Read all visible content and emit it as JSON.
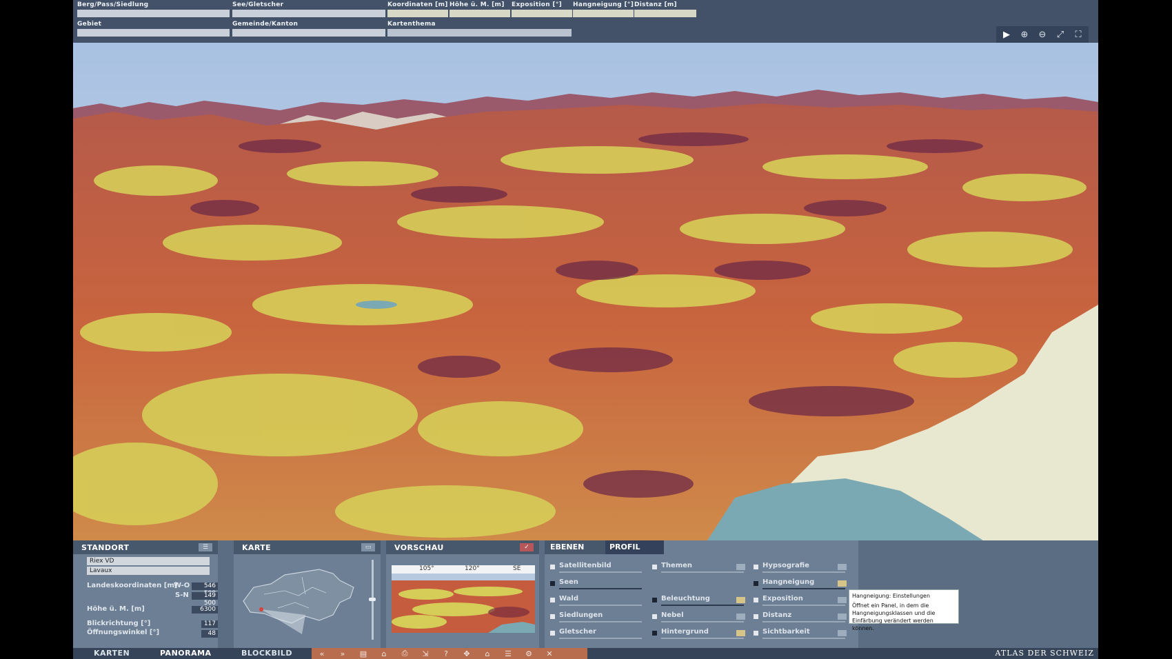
{
  "topbar": {
    "fields": {
      "berg": "Berg/Pass/Siedlung",
      "see": "See/Gletscher",
      "koord": "Koordinaten [m]",
      "hoehe": "Höhe ü. M. [m]",
      "expo": "Exposition [°]",
      "neigung": "Hangneigung [°]",
      "distanz": "Distanz [m]",
      "gebiet": "Gebiet",
      "gemeinde": "Gemeinde/Kanton",
      "kartenthema": "Kartenthema"
    }
  },
  "standort": {
    "title": "STANDORT",
    "place": "Riex  VD",
    "region": "Lavaux",
    "koord_label": "Landeskoordinaten [m]",
    "wo_label": "W-O",
    "wo_value": "546 500",
    "sn_label": "S-N",
    "sn_value": "149 500",
    "hoehe_label": "Höhe ü. M. [m]",
    "hoehe_value": "6300",
    "blick_label": "Blickrichtung [°]",
    "blick_value": "117",
    "winkel_label": "Öffnungswinkel [°]",
    "winkel_value": "48"
  },
  "karte": {
    "title": "KARTE"
  },
  "vorschau": {
    "title": "VORSCHAU",
    "deg1": "105°",
    "deg2": "120°",
    "dir": "SE"
  },
  "ebenen": {
    "tab_ebenen": "EBENEN",
    "tab_profil": "PROFIL",
    "col1": [
      "Satellitenbild",
      "Seen",
      "Wald",
      "Siedlungen",
      "Gletscher"
    ],
    "col2": [
      "Themen",
      "Beleuchtung",
      "Nebel",
      "Hintergrund"
    ],
    "col3": [
      "Hypsografie",
      "Hangneigung",
      "Exposition",
      "Distanz",
      "Sichtbarkeit"
    ]
  },
  "tooltip": {
    "title": "Hangneigung: Einstellungen",
    "text": "Öffnet ein Panel, in dem die Hangneigungsklassen und die Einfärbung verändert werden können."
  },
  "nav": {
    "karten": "KARTEN",
    "panorama": "PANORAMA",
    "blockbild": "BLOCKBILD",
    "brand": "ATLAS DER SCHWEIZ"
  },
  "colors": {
    "steep": "#7a2c3e",
    "medium": "#c4553a",
    "gentle": "#d8cf5a",
    "flat": "#e8e7b8",
    "lake": "#7aa9b3",
    "sky": "#b8cde6"
  }
}
